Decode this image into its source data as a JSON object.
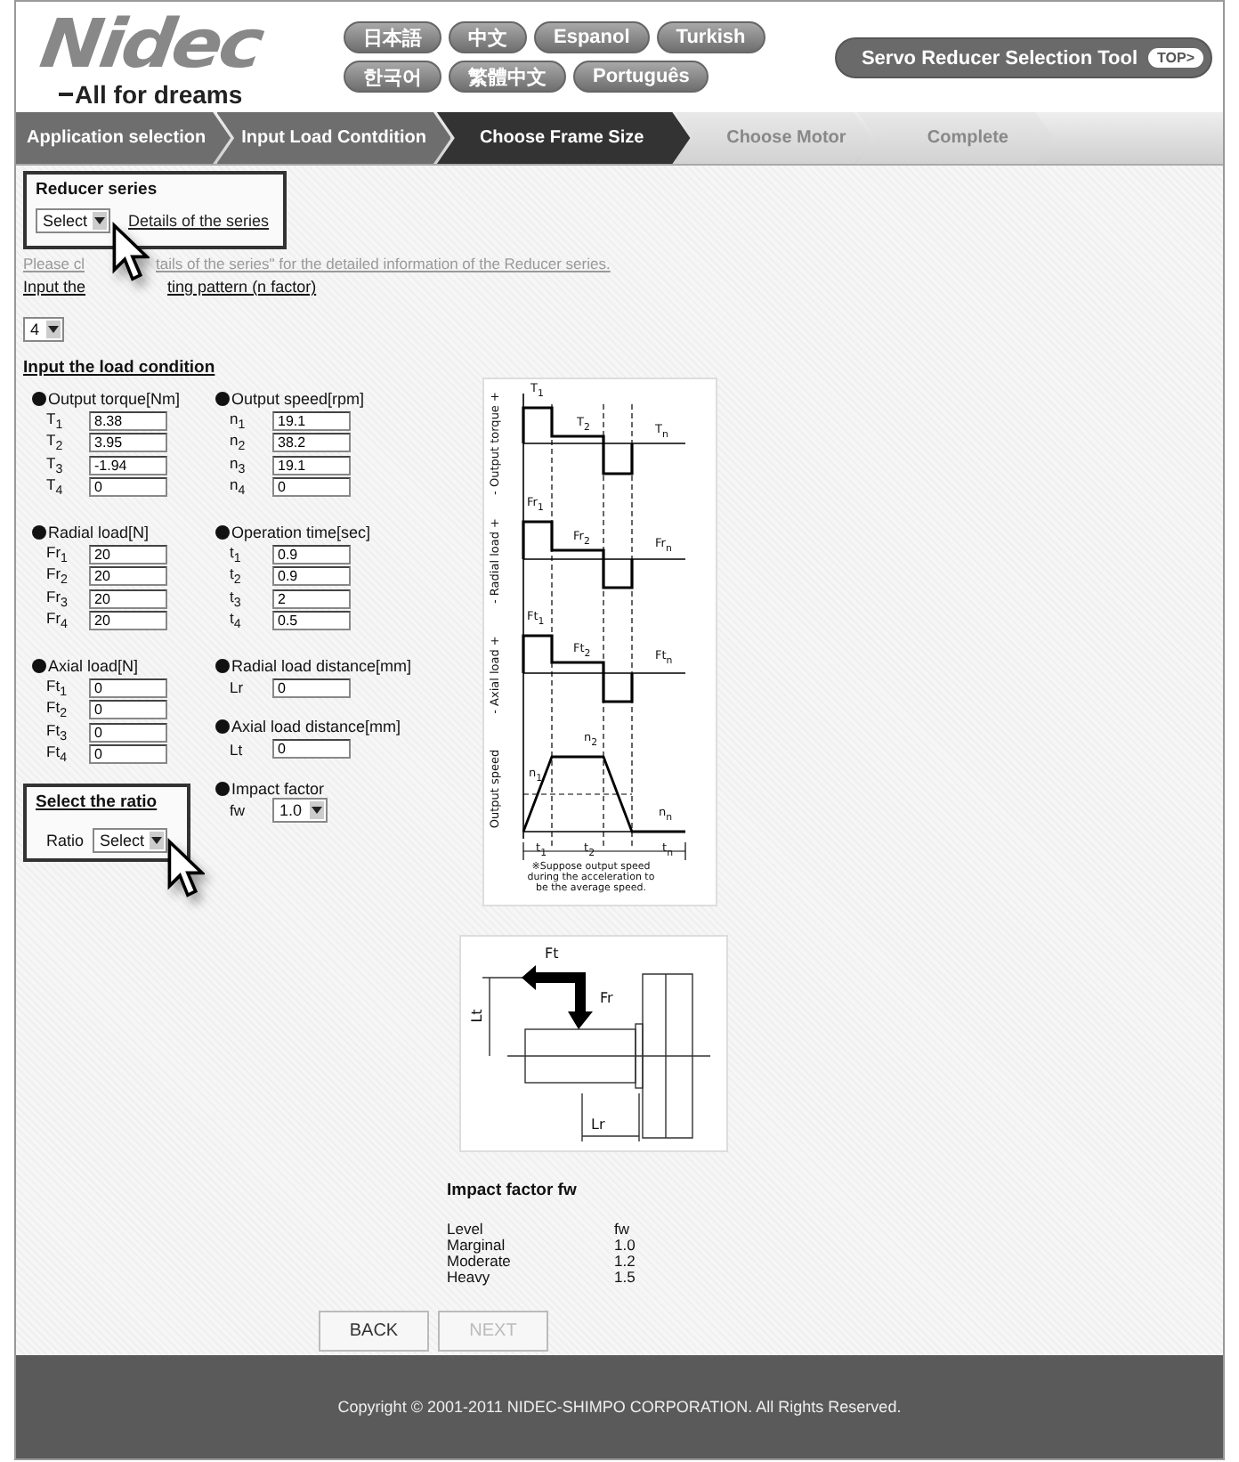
{
  "brand": {
    "logo": "Nidec",
    "tagline": "All for dreams"
  },
  "languages": [
    "日本語",
    "中文",
    "Espanol",
    "Turkish",
    "한국어",
    "繁體中文",
    "Português"
  ],
  "tool_button": {
    "label": "Servo Reducer Selection Tool",
    "badge": "TOP>"
  },
  "steps": [
    {
      "label": "Application selection",
      "done": true,
      "selected": false
    },
    {
      "label": "Input Load Contdition",
      "done": true,
      "selected": false
    },
    {
      "label": "Choose Frame Size",
      "done": false,
      "selected": true
    },
    {
      "label": "Choose Motor",
      "done": false,
      "selected": false
    },
    {
      "label": "Complete",
      "done": false,
      "selected": false
    }
  ],
  "reducer_series": {
    "title": "Reducer series",
    "select": "Select",
    "link": "Details of the series"
  },
  "hint_parts": [
    "Please cl",
    "tails of the series\" for the detailed information of the Reducer series."
  ],
  "pattern_parts": [
    "Input the",
    "ting pattern (n factor)"
  ],
  "pattern_select": "4",
  "load_title": "Input the load condition",
  "left_groups": [
    {
      "title": "Output torque[Nm]",
      "fields": [
        {
          "label": "T$_{1}$",
          "value": "8.38"
        },
        {
          "label": "T$_{2}$",
          "value": "3.95"
        },
        {
          "label": "T$_{3}$",
          "value": "-1.94"
        },
        {
          "label": "T$_{4}$",
          "value": "0"
        }
      ]
    },
    {
      "title": "Radial load[N]",
      "fields": [
        {
          "label": "Fr$_{1}$",
          "value": "20"
        },
        {
          "label": "Fr$_{2}$",
          "value": "20"
        },
        {
          "label": "Fr$_{3}$",
          "value": "20"
        },
        {
          "label": "Fr$_{4}$",
          "value": "20"
        }
      ]
    },
    {
      "title": "Axial load[N]",
      "fields": [
        {
          "label": "Ft$_{1}$",
          "value": "0"
        },
        {
          "label": "Ft$_{2}$",
          "value": "0"
        },
        {
          "label": "Ft$_{3}$",
          "value": "0"
        },
        {
          "label": "Ft$_{4}$",
          "value": "0"
        }
      ]
    }
  ],
  "right_groups": [
    {
      "kind": "inputs",
      "title": "Output speed[rpm]",
      "fields": [
        {
          "label": "n$_{1}$",
          "value": "19.1"
        },
        {
          "label": "n$_{2}$",
          "value": "38.2"
        },
        {
          "label": "n$_{3}$",
          "value": "19.1"
        },
        {
          "label": "n$_{4}$",
          "value": "0"
        }
      ]
    },
    {
      "kind": "inputs",
      "title": "Operation time[sec]",
      "fields": [
        {
          "label": "t$_{1}$",
          "value": "0.9"
        },
        {
          "label": "t$_{2}$",
          "value": "0.9"
        },
        {
          "label": "t$_{3}$",
          "value": "2"
        },
        {
          "label": "t$_{4}$",
          "value": "0.5"
        }
      ]
    },
    {
      "kind": "inputs",
      "title": "Radial load distance[mm]",
      "fields": [
        {
          "label": "Lr",
          "value": "0"
        }
      ]
    },
    {
      "kind": "inputs",
      "title": "Axial load distance[mm]",
      "fields": [
        {
          "label": "Lt",
          "value": "0"
        }
      ]
    },
    {
      "kind": "select",
      "title": "Impact factor",
      "fields": [
        {
          "label": "fw",
          "value": "1.0"
        }
      ]
    }
  ],
  "ratio": {
    "title": "Select the ratio",
    "label": "Ratio",
    "select": "Select"
  },
  "load_diagram": {
    "axis_labels": [
      "- Output torque +",
      "- Radial load +",
      "- Axial load +",
      "Output speed"
    ],
    "labels": [
      "T$_{1}$",
      "T$_{2}$",
      "T$_{n}$",
      "Fr$_{1}$",
      "Fr$_{2}$",
      "Fr$_{n}$",
      "Ft$_{1}$",
      "Ft$_{2}$",
      "Ft$_{n}$",
      "n$_{1}$",
      "n$_{2}$",
      "n$_{n}$",
      "t$_{1}$",
      "t$_{2}$",
      "t$_{n}$"
    ],
    "note": "※Suppose output speed during the acceleration to be the average speed."
  },
  "shaft_diagram": {
    "labels": [
      "Ft",
      "Fr",
      "Lt",
      "Lr"
    ]
  },
  "impact_table": {
    "title": "Impact factor fw",
    "header": [
      "Level",
      "fw"
    ],
    "rows": [
      [
        "Marginal",
        "1.0"
      ],
      [
        "Moderate",
        "1.2"
      ],
      [
        "Heavy",
        "1.5"
      ]
    ]
  },
  "buttons": [
    {
      "label": "BACK",
      "disabled": false
    },
    {
      "label": "NEXT",
      "disabled": true
    }
  ],
  "footer": "Copyright © 2001-2011 NIDEC-SHIMPO CORPORATION. All Rights Reserved."
}
